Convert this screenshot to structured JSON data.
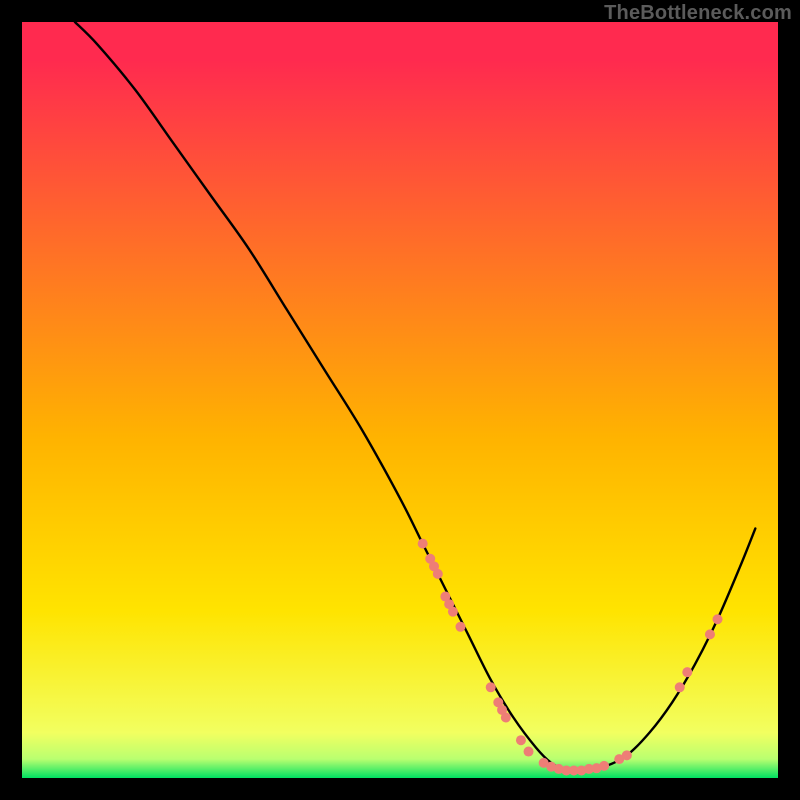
{
  "watermark": "TheBottleneck.com",
  "chart_data": {
    "type": "line",
    "title": "",
    "xlabel": "",
    "ylabel": "",
    "xlim": [
      0,
      100
    ],
    "ylim": [
      0,
      100
    ],
    "grid": false,
    "legend": false,
    "background_gradient_top": "#ff2a4f",
    "background_gradient_mid": "#ffd400",
    "background_gradient_bottom": "#00e062",
    "curve": {
      "name": "bottleneck-curve",
      "color": "#000000",
      "x": [
        7,
        10,
        15,
        20,
        25,
        30,
        35,
        40,
        45,
        50,
        53,
        56,
        59,
        62,
        65,
        68,
        70,
        72,
        74,
        77,
        80,
        83,
        86,
        89,
        92,
        95,
        97
      ],
      "y": [
        100,
        97,
        91,
        84,
        77,
        70,
        62,
        54,
        46,
        37,
        31,
        25,
        19,
        13,
        8,
        4,
        2,
        1,
        1,
        1.5,
        3,
        6,
        10,
        15,
        21,
        28,
        33
      ]
    },
    "markers": {
      "name": "data-points",
      "color": "#ee7e76",
      "radius": 5,
      "points": [
        {
          "x": 53,
          "y": 31
        },
        {
          "x": 54,
          "y": 29
        },
        {
          "x": 54.5,
          "y": 28
        },
        {
          "x": 55,
          "y": 27
        },
        {
          "x": 56,
          "y": 24
        },
        {
          "x": 56.5,
          "y": 23
        },
        {
          "x": 57,
          "y": 22
        },
        {
          "x": 58,
          "y": 20
        },
        {
          "x": 62,
          "y": 12
        },
        {
          "x": 63,
          "y": 10
        },
        {
          "x": 63.5,
          "y": 9
        },
        {
          "x": 64,
          "y": 8
        },
        {
          "x": 66,
          "y": 5
        },
        {
          "x": 67,
          "y": 3.5
        },
        {
          "x": 69,
          "y": 2
        },
        {
          "x": 70,
          "y": 1.5
        },
        {
          "x": 71,
          "y": 1.2
        },
        {
          "x": 72,
          "y": 1
        },
        {
          "x": 73,
          "y": 1
        },
        {
          "x": 74,
          "y": 1
        },
        {
          "x": 75,
          "y": 1.2
        },
        {
          "x": 76,
          "y": 1.3
        },
        {
          "x": 77,
          "y": 1.6
        },
        {
          "x": 79,
          "y": 2.5
        },
        {
          "x": 80,
          "y": 3
        },
        {
          "x": 87,
          "y": 12
        },
        {
          "x": 88,
          "y": 14
        },
        {
          "x": 91,
          "y": 19
        },
        {
          "x": 92,
          "y": 21
        }
      ]
    }
  }
}
